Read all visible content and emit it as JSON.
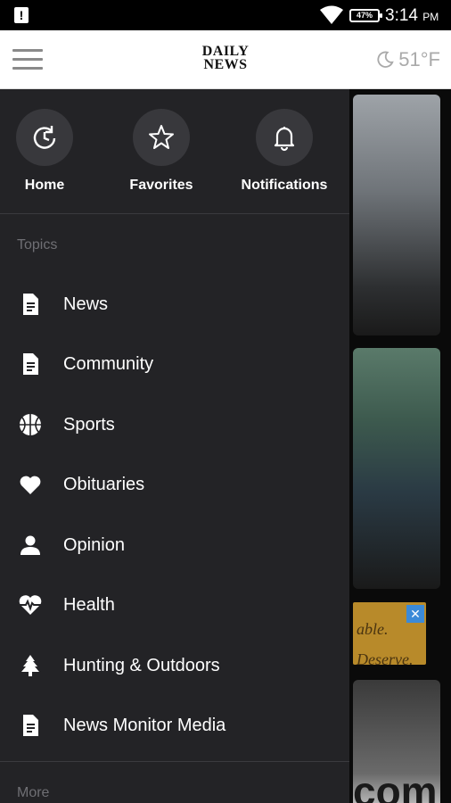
{
  "status_bar": {
    "battery": "47%",
    "time": "3:14",
    "ampm": "PM"
  },
  "header": {
    "logo_line1": "DAILY",
    "logo_line2": "NEWS",
    "temperature": "51°F"
  },
  "quick_actions": [
    {
      "label": "Home",
      "icon": "home-refresh-icon"
    },
    {
      "label": "Favorites",
      "icon": "star-icon"
    },
    {
      "label": "Notifications",
      "icon": "bell-icon"
    }
  ],
  "topics_title": "Topics",
  "topics": [
    {
      "label": "News",
      "icon": "document-icon"
    },
    {
      "label": "Community",
      "icon": "document-icon"
    },
    {
      "label": "Sports",
      "icon": "basketball-icon"
    },
    {
      "label": "Obituaries",
      "icon": "heart-icon"
    },
    {
      "label": "Opinion",
      "icon": "person-icon"
    },
    {
      "label": "Health",
      "icon": "heart-pulse-icon"
    },
    {
      "label": "Hunting & Outdoors",
      "icon": "tree-icon"
    },
    {
      "label": "News Monitor Media",
      "icon": "document-icon"
    }
  ],
  "more_title": "More",
  "background": {
    "ad_text_1": "able.",
    "ad_text_2": "Deserve.",
    "card3_text": "com"
  },
  "colors": {
    "drawer_bg": "#232326",
    "circle_bg": "#38383c",
    "section_title": "#6f6f74"
  }
}
